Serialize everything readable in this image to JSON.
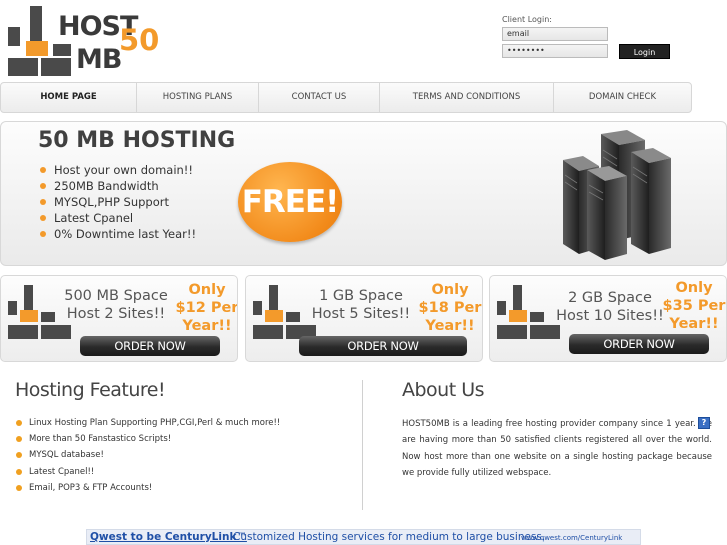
{
  "logo": {
    "host": "HOST",
    "mb": "MB",
    "fifty": "50"
  },
  "login": {
    "label": "Client Login:",
    "email_value": "email",
    "password_value": "••••••••",
    "button": "Login"
  },
  "nav": {
    "items": [
      {
        "label": "HOME PAGE"
      },
      {
        "label": "HOSTING PLANS"
      },
      {
        "label": "CONTACT US"
      },
      {
        "label": "TERMS AND CONDITIONS"
      },
      {
        "label": "DOMAIN CHECK"
      }
    ]
  },
  "banner": {
    "title": "50 MB HOSTING",
    "points": [
      "Host your own domain!!",
      "250MB Bandwidth",
      "MYSQL,PHP Support",
      "Latest Cpanel",
      "0% Downtime last Year!!"
    ],
    "free": "FREE!"
  },
  "plans": [
    {
      "space_line1": "500 MB Space",
      "space_line2": "Host 2 Sites!!",
      "price_line1": "Only",
      "price_line2": "$12 Per",
      "price_line3": "Year!!",
      "button": "ORDER NOW"
    },
    {
      "space_line1": "1 GB Space",
      "space_line2": "Host 5 Sites!!",
      "price_line1": "Only",
      "price_line2": "$18 Per",
      "price_line3": "Year!!",
      "button": "ORDER NOW"
    },
    {
      "space_line1": "2 GB Space",
      "space_line2": "Host 10 Sites!!",
      "price_line1": "Only",
      "price_line2": "$35 Per",
      "price_line3": "Year!!",
      "button": "ORDER NOW"
    }
  ],
  "features": {
    "title": "Hosting Feature!",
    "items": [
      "Linux Hosting Plan Supporting PHP,CGI,Perl & much more!!",
      "More than 50 Fanstastico Scripts!",
      "MYSQL database!",
      "Latest Cpanel!!",
      "Email, POP3 & FTP Accounts!"
    ]
  },
  "about": {
    "title": "About Us",
    "text": "HOST50MB is a leading free hosting provider company since 1 year. We are having more than 50 satisfied clients registered all over the world. Now host more than one website on a single hosting package because we provide fully utilized webspace.",
    "help_icon": "?"
  },
  "ad": {
    "link": "Qwest to be CenturyLink™",
    "desc": "Customized Hosting services for medium to large business.",
    "url": "www.qwest.com/CenturyLink"
  },
  "colors": {
    "accent": "#f39a2b",
    "dark": "#4a4a4a",
    "link": "#1f4fa6"
  }
}
